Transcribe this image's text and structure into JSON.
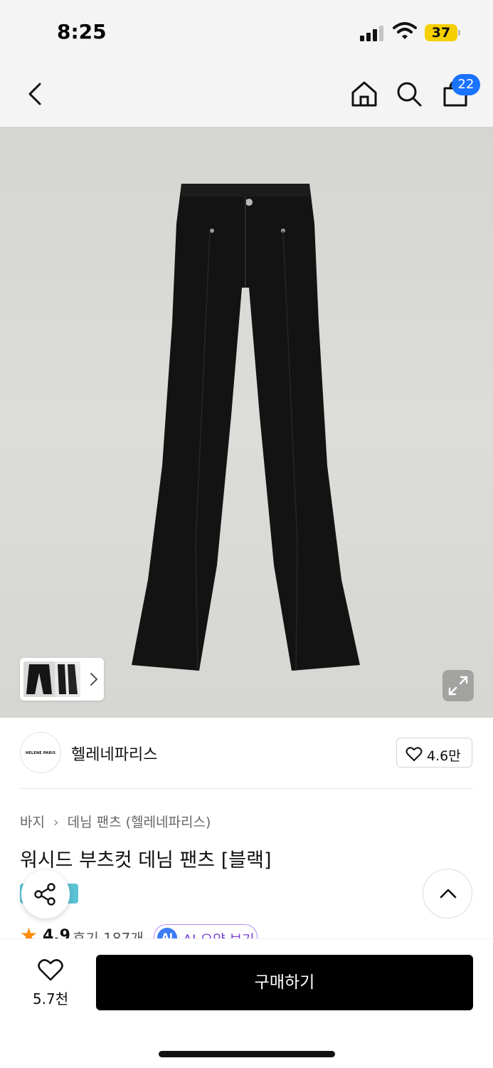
{
  "status_bar": {
    "time": "8:25",
    "battery": "37",
    "icons": [
      "signal-icon",
      "wifi-icon",
      "battery-icon"
    ]
  },
  "nav": {
    "icons": [
      "back-icon",
      "home-icon",
      "search-icon",
      "shopping-bag-icon"
    ],
    "cart_badge": "22"
  },
  "gallery": {
    "icons": [
      "thumbnail-chevron-icon",
      "expand-icon"
    ]
  },
  "brand": {
    "logo_text": "HELENE PARIS",
    "name": "헬레네파리스",
    "like_count": "4.6만"
  },
  "product": {
    "breadcrumb": [
      "바지",
      "데님 팬츠 (헬레네파리스)"
    ],
    "title": "워시드 부츠컷 데님 팬츠 [블랙]",
    "rating": "4.9",
    "review_count": "후기 187개",
    "ai_chip_icon_text": "AI",
    "ai_chip_label": "AI 요약 보기"
  },
  "bottom": {
    "wish_count": "5.7천",
    "buy_label": "구매하기"
  },
  "colors": {
    "accent_blue": "#1a73ff",
    "star": "#ff8a00",
    "ai_purple": "#7a3fd6",
    "buy_bg": "#000000"
  }
}
